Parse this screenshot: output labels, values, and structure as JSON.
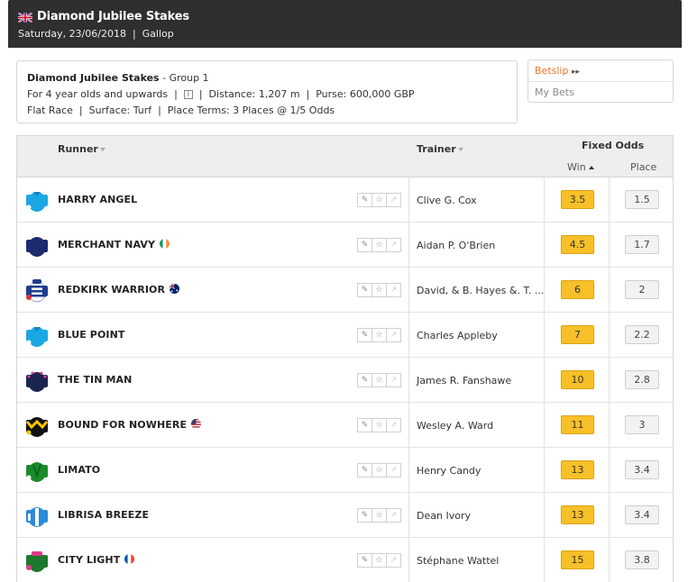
{
  "header": {
    "title": "Diamond Jubilee Stakes",
    "subtitle": "Saturday, 23/06/2018  |  Gallop"
  },
  "info": {
    "race_name": "Diamond Jubilee Stakes",
    "race_group": " - Group 1",
    "line2_a": "For 4 year olds and upwards  |",
    "line2_info": "i",
    "line2_b": "|  Distance: 1,207 m  |  Purse: 600,000 GBP",
    "line3": "Flat Race  |  Surface: Turf  |  Place Terms: 3 Places @ 1/5 Odds"
  },
  "betslip": {
    "label": "Betslip",
    "arrows": "▸▸",
    "mybets": "My Bets"
  },
  "table": {
    "col_runner": "Runner",
    "col_trainer": "Trainer",
    "col_fixed_odds": "Fixed Odds",
    "col_win": "Win",
    "col_place": "Place"
  },
  "runners": [
    {
      "name": "HARRY ANGEL",
      "trainer": "Clive G. Cox",
      "win": "3.5",
      "place": "1.5",
      "nat": "",
      "silk": "lightblue"
    },
    {
      "name": "MERCHANT NAVY",
      "trainer": "Aidan P. O'Brien",
      "win": "4.5",
      "place": "1.7",
      "nat": "ireland",
      "silk": "navy"
    },
    {
      "name": "REDKIRK WARRIOR",
      "trainer": "David, & B. Hayes &. T. ...",
      "win": "6",
      "place": "2",
      "nat": "australia",
      "silk": "hoops"
    },
    {
      "name": "BLUE POINT",
      "trainer": "Charles Appleby",
      "win": "7",
      "place": "2.2",
      "nat": "",
      "silk": "lightblue"
    },
    {
      "name": "THE TIN MAN",
      "trainer": "James R. Fanshawe",
      "win": "10",
      "place": "2.8",
      "nat": "",
      "silk": "navypink"
    },
    {
      "name": "BOUND FOR NOWHERE",
      "trainer": "Wesley A. Ward",
      "win": "11",
      "place": "3",
      "nat": "usa",
      "silk": "blackyellow"
    },
    {
      "name": "LIMATO",
      "trainer": "Henry Candy",
      "win": "13",
      "place": "3.4",
      "nat": "",
      "silk": "green"
    },
    {
      "name": "LIBRISA BREEZE",
      "trainer": "Dean Ivory",
      "win": "13",
      "place": "3.4",
      "nat": "",
      "silk": "bluewhite"
    },
    {
      "name": "CITY LIGHT",
      "trainer": "Stéphane Wattel",
      "win": "15",
      "place": "3.8",
      "nat": "france",
      "silk": "greenpink"
    }
  ],
  "colors": {
    "header_bg": "#2f2f2f",
    "accent_orange": "#e87722",
    "win_button": "#f7c028"
  },
  "icons": {
    "flag": "uk-flag-icon",
    "row_icons": [
      "pencil-icon",
      "star-icon",
      "chart-icon"
    ]
  }
}
